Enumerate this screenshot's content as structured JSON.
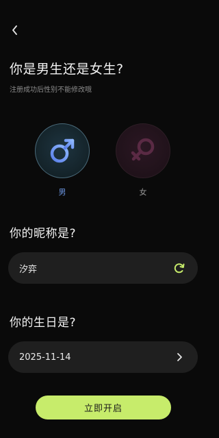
{
  "header": {
    "back_icon": "chevron-left-icon"
  },
  "gender_section": {
    "title": "你是男生还是女生?",
    "subtitle": "注册成功后性别不能修改哦",
    "options": [
      {
        "label": "男",
        "icon": "male-symbol-icon",
        "selected": true,
        "color": "#6b95e0"
      },
      {
        "label": "女",
        "icon": "female-symbol-icon",
        "selected": false,
        "color": "#5a2a44"
      }
    ]
  },
  "nickname_section": {
    "title": "你的昵称是?",
    "value": "汐弈",
    "refresh_icon": "refresh-icon",
    "accent_color": "#c7ec6b"
  },
  "birthday_section": {
    "title": "你的生日是?",
    "value": "2025-11-14",
    "chevron_icon": "chevron-right-icon"
  },
  "submit": {
    "label": "立即开启",
    "color": "#c7ec6b"
  }
}
